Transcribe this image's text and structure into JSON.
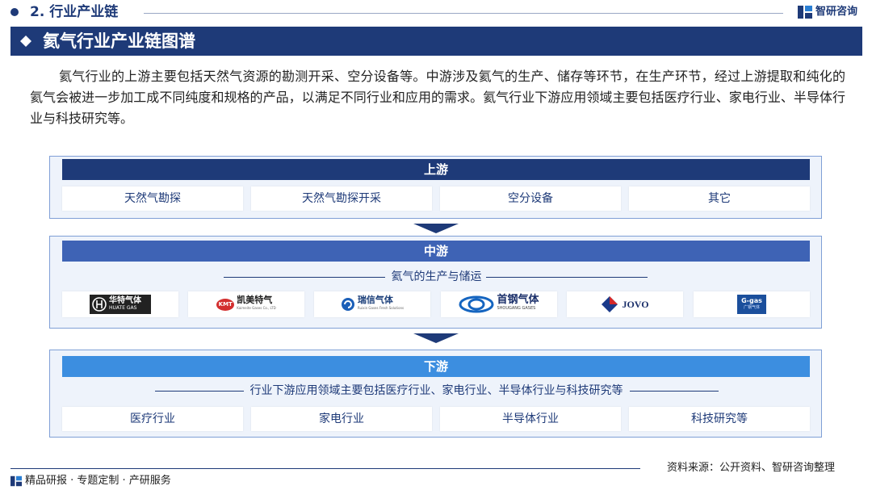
{
  "header": {
    "section": "2. 行业产业链",
    "brand": "智研咨询"
  },
  "banner": {
    "title": "氦气行业产业链图谱"
  },
  "intro": "氦气行业的上游主要包括天然气资源的勘测开采、空分设备等。中游涉及氦气的生产、储存等环节，在生产环节，经过上游提取和纯化的氦气会被进一步加工成不同纯度和规格的产品，以满足不同行业和应用的需求。氦气行业下游应用领域主要包括医疗行业、家电行业、半导体行业与科技研究等。",
  "upstream": {
    "label": "上游",
    "items": [
      "天然气勘探",
      "天然气勘探开采",
      "空分设备",
      "其它"
    ]
  },
  "midstream": {
    "label": "中游",
    "subtitle": "氦气的生产与储运",
    "companies": [
      {
        "name": "华特气体",
        "sub": "HUATE GAS"
      },
      {
        "name": "凯美特气",
        "sub": "Kaimeite Gases Co., LTD",
        "badge": "KMT"
      },
      {
        "name": "瑞信气体",
        "sub": "Ruixin Gases Fresh Solutions"
      },
      {
        "name": "首钢气体",
        "sub": "SHOUGANG GASES"
      },
      {
        "name": "JOVO"
      },
      {
        "name": "G-gas",
        "sub": "广钢气体"
      }
    ]
  },
  "downstream": {
    "label": "下游",
    "subtitle": "行业下游应用领域主要包括医疗行业、家电行业、半导体行业与科技研究等",
    "items": [
      "医疗行业",
      "家电行业",
      "半导体行业",
      "科技研究等"
    ]
  },
  "footer": {
    "left": "精品研报 · 专题定制 · 产研服务",
    "source": "资料来源：公开资料、智研咨询整理"
  },
  "colors": {
    "navy": "#1e3a78",
    "mid_bar": "#3e63b5",
    "down_bar": "#3c8ee0",
    "panel": "#eef3fb"
  }
}
